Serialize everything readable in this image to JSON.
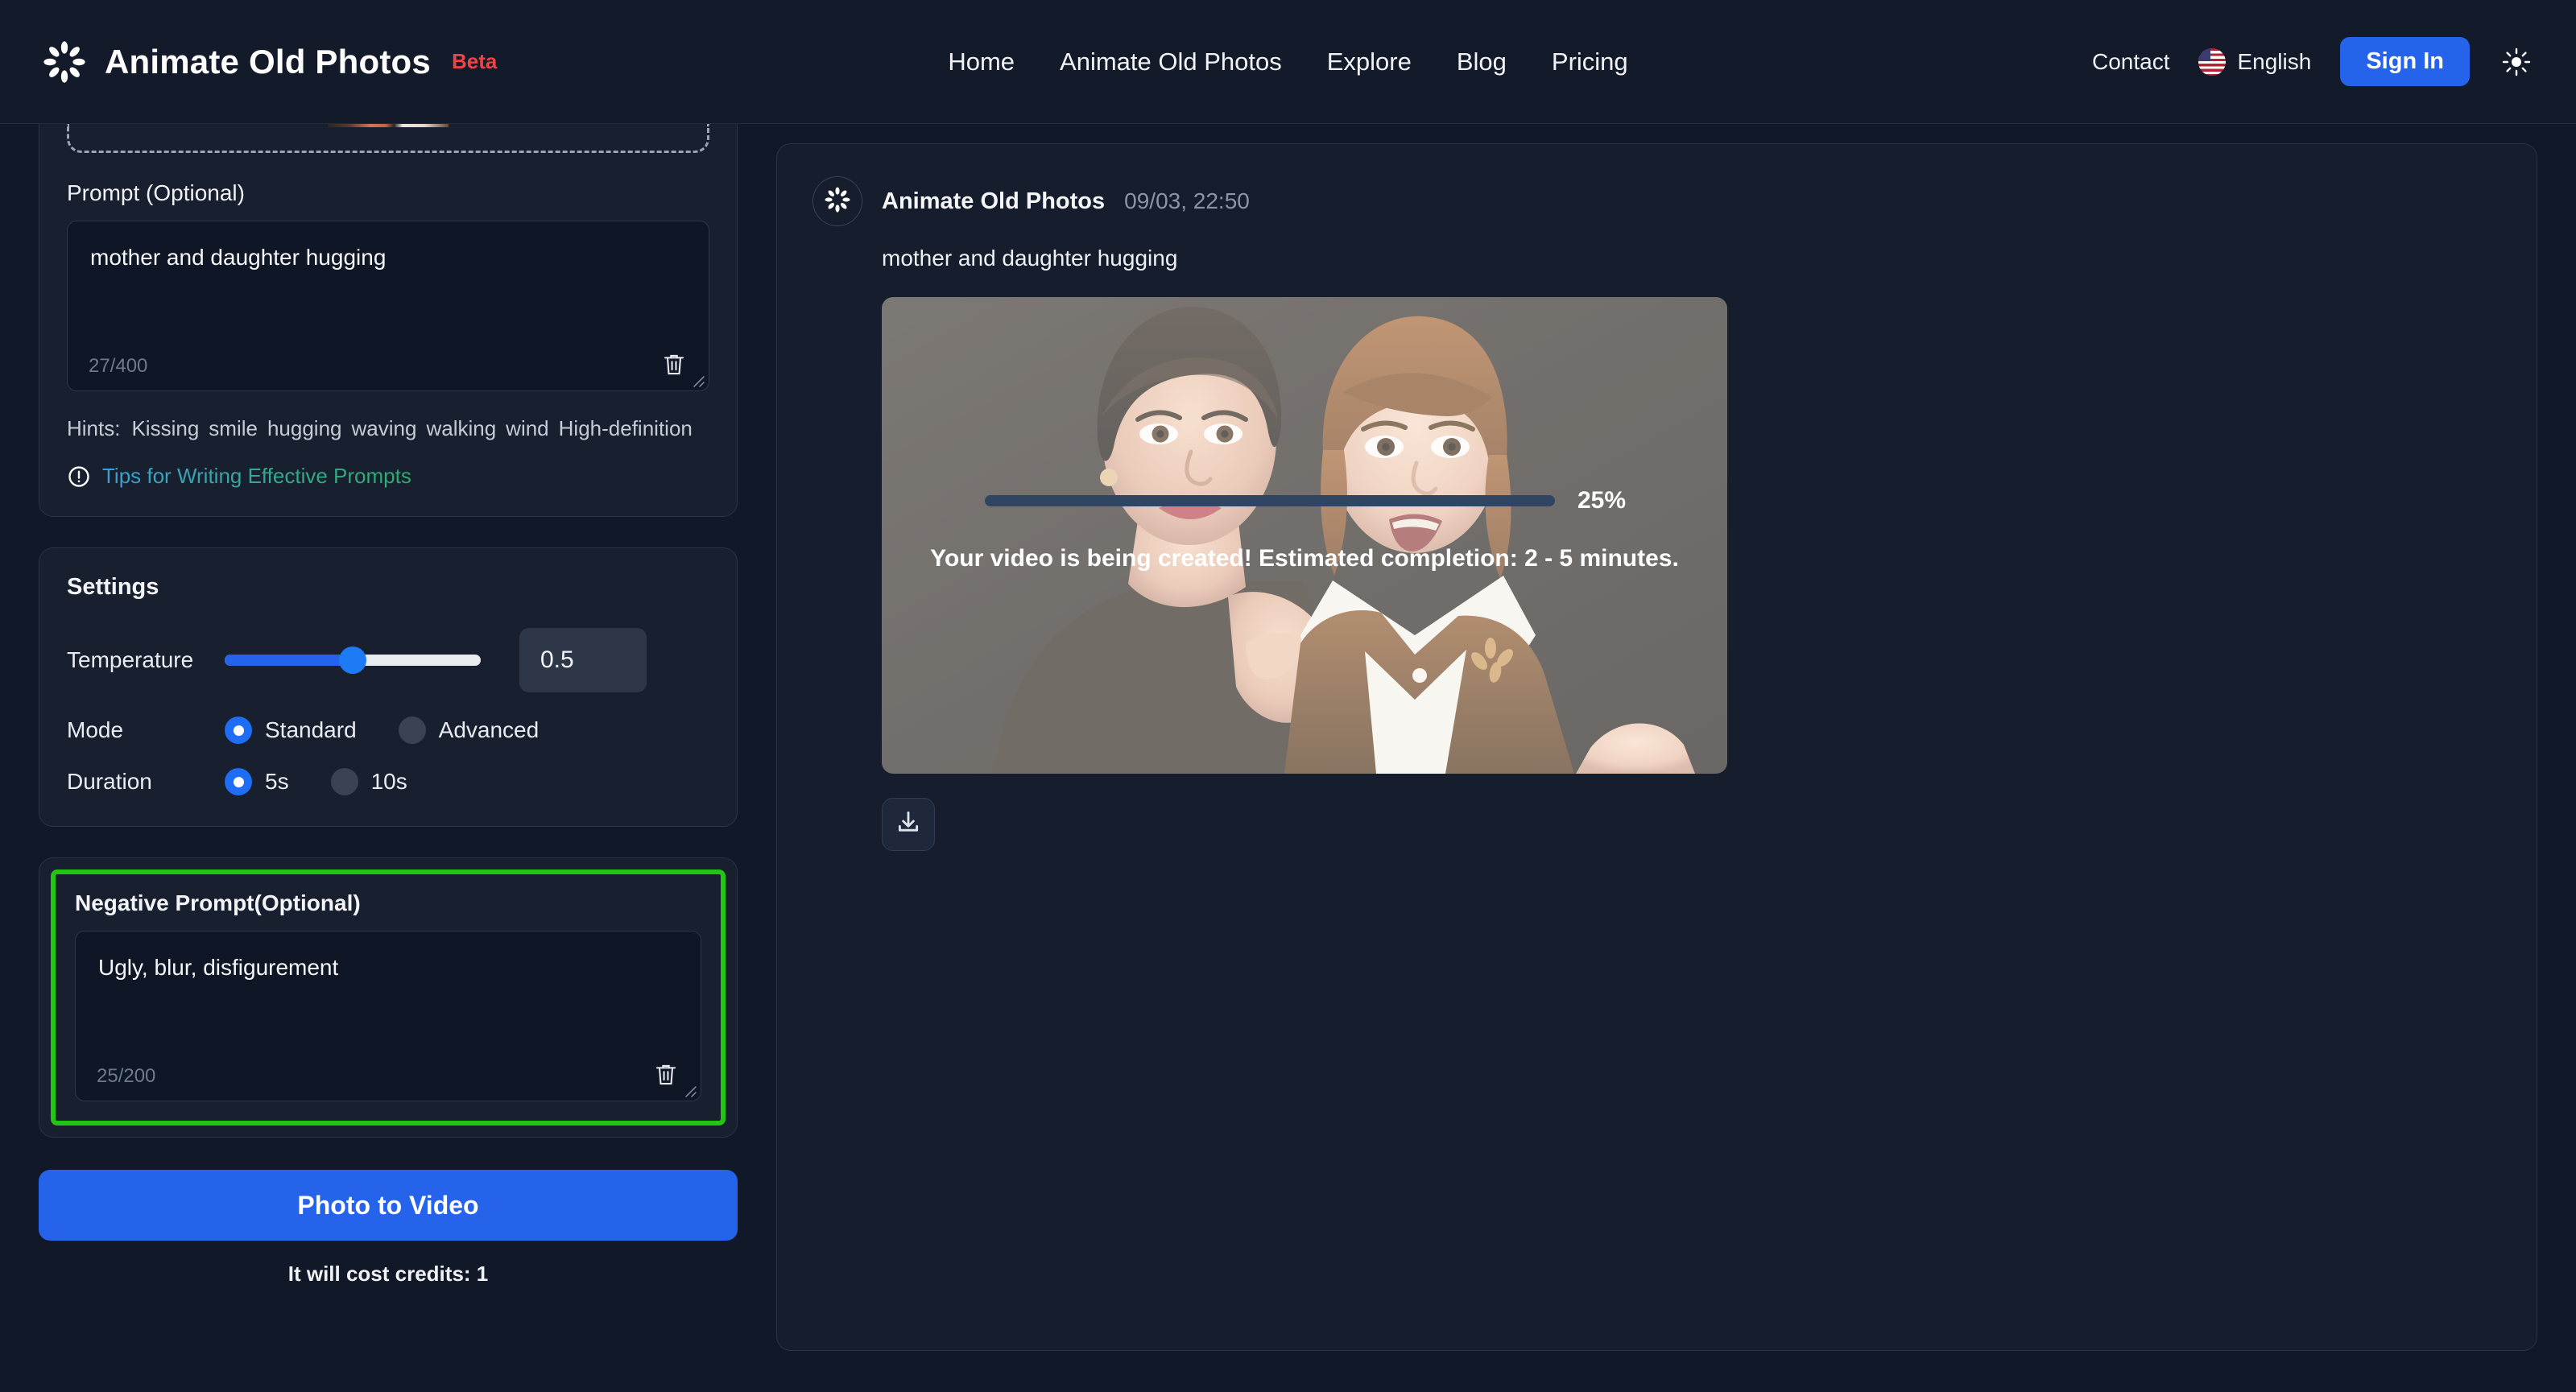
{
  "header": {
    "brand_title": "Animate Old Photos",
    "brand_badge": "Beta",
    "logo_icon": "flower-spinner-icon",
    "nav": [
      {
        "label": "Home"
      },
      {
        "label": "Animate Old Photos"
      },
      {
        "label": "Explore"
      },
      {
        "label": "Blog"
      },
      {
        "label": "Pricing"
      }
    ],
    "contact_label": "Contact",
    "language_label": "English",
    "language_flag_icon": "us-flag-icon",
    "signin_label": "Sign In",
    "theme_icon": "sun-icon"
  },
  "left_panel": {
    "prompt": {
      "label": "Prompt (Optional)",
      "value": "mother and daughter hugging",
      "counter": "27/400",
      "clear_icon": "trash-icon",
      "resize_icon": "resize-handle-icon"
    },
    "hints": {
      "label": "Hints:",
      "words": [
        "Kissing",
        "smile",
        "hugging",
        "waving",
        "walking",
        "wind",
        "High-definition"
      ]
    },
    "tips": {
      "icon": "info-circle-icon",
      "label": "Tips for Writing Effective Prompts"
    },
    "settings": {
      "title": "Settings",
      "temperature": {
        "label": "Temperature",
        "value": "0.5",
        "percent": 50
      },
      "mode": {
        "label": "Mode",
        "options": [
          {
            "label": "Standard",
            "selected": true
          },
          {
            "label": "Advanced",
            "selected": false
          }
        ]
      },
      "duration": {
        "label": "Duration",
        "options": [
          {
            "label": "5s",
            "selected": true
          },
          {
            "label": "10s",
            "selected": false
          }
        ]
      }
    },
    "negative_prompt": {
      "label": "Negative Prompt(Optional)",
      "value": "Ugly, blur, disfigurement",
      "counter": "25/200",
      "clear_icon": "trash-icon",
      "resize_icon": "resize-handle-icon",
      "highlight_color": "#22c514"
    },
    "submit": {
      "label": "Photo to Video",
      "credits_note": "It will cost credits: 1",
      "color": "#2563eb"
    }
  },
  "right_panel": {
    "message": {
      "avatar_icon": "flower-spinner-icon",
      "author": "Animate Old Photos",
      "timestamp": "09/03, 22:50",
      "prompt_echo": "mother and daughter hugging"
    },
    "media": {
      "alt": "vintage photo of a woman and a young girl hugging",
      "progress_percent_label": "25%",
      "progress_percent": 25,
      "progress_color": "#a855f7",
      "status_text": "Your video is being created! Estimated completion: 2 - 5 minutes."
    },
    "download": {
      "icon": "download-icon"
    }
  }
}
